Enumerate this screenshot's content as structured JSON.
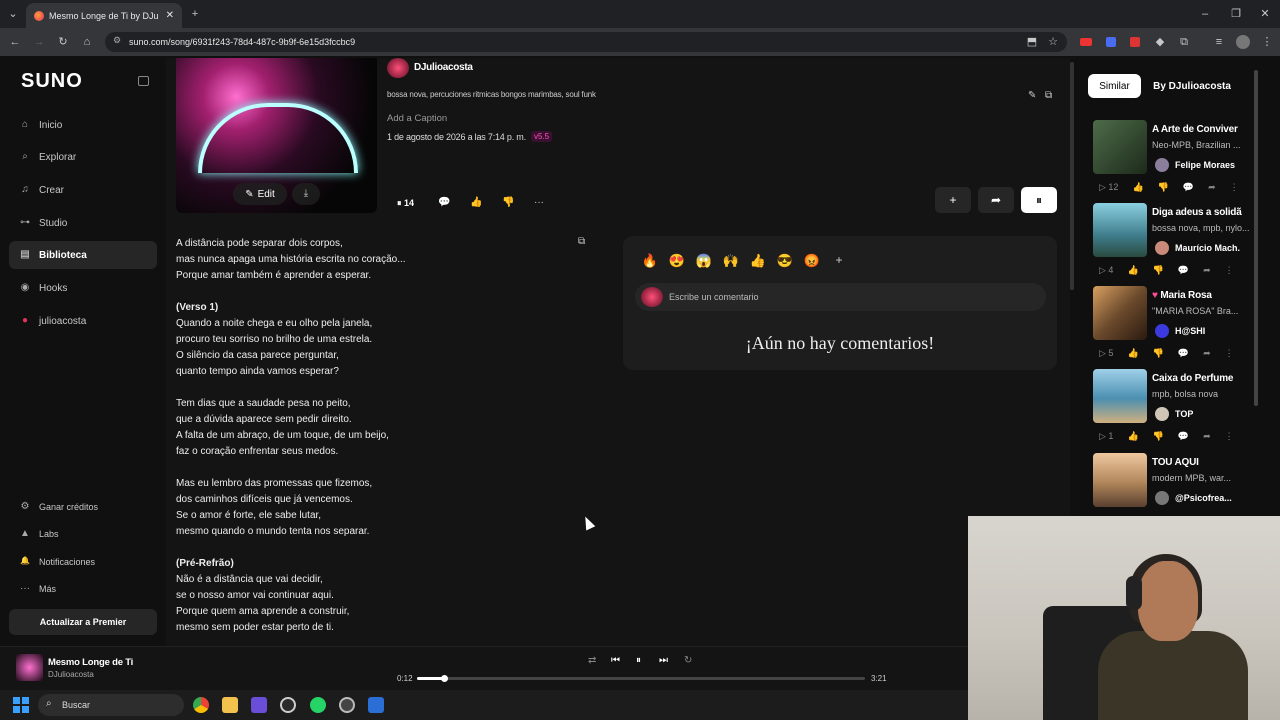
{
  "browser": {
    "tab_title": "Mesmo Longe de Ti by DJu",
    "url": "suno.com/song/6931f243-78d4-487c-9b9f-6e15d3fccbc9"
  },
  "sidebar": {
    "logo": "SUNO",
    "items": [
      {
        "label": "Inicio",
        "icon": "⌂"
      },
      {
        "label": "Explorar",
        "icon": "⌕"
      },
      {
        "label": "Crear",
        "icon": "♫"
      },
      {
        "label": "Studio",
        "icon": "⊶"
      },
      {
        "label": "Biblioteca",
        "icon": "▤"
      },
      {
        "label": "Hooks",
        "icon": "◉"
      },
      {
        "label": "julioacosta",
        "icon": "●"
      }
    ],
    "bottom_items": [
      {
        "label": "Ganar créditos",
        "icon": "⚙"
      },
      {
        "label": "Labs",
        "icon": "▲"
      },
      {
        "label": "Notificaciones",
        "icon": "🔔"
      },
      {
        "label": "Más",
        "icon": "···"
      }
    ],
    "premier_label": "Actualizar a Premier"
  },
  "song": {
    "artist": "DJulioacosta",
    "tags": "bossa nova, percuciones ritmicas bongos marimbas, soul funk",
    "caption_placeholder": "Add a Caption",
    "date": "1 de agosto de 2026 a las 7:14 p. m.",
    "version": "v5.5",
    "edit_label": "Edit",
    "play_count": "14"
  },
  "lyrics": [
    "A distância pode separar dois corpos,",
    "mas nunca apaga uma história escrita no coração...",
    "Porque amar também é aprender a esperar.",
    "",
    "(Verso 1)",
    "Quando a noite chega e eu olho pela janela,",
    "procuro teu sorriso no brilho de uma estrela.",
    "O silêncio da casa parece perguntar,",
    "quanto tempo ainda vamos esperar?",
    "",
    "Tem dias que a saudade pesa no peito,",
    "que a dúvida aparece sem pedir direito.",
    "A falta de um abraço, de um toque, de um beijo,",
    "faz o coração enfrentar seus medos.",
    "",
    "Mas eu lembro das promessas que fizemos,",
    "dos caminhos difíceis que já vencemos.",
    "Se o amor é forte, ele sabe lutar,",
    "mesmo quando o mundo tenta nos separar.",
    "",
    "(Pré-Refrão)",
    "Não é a distância que vai decidir,",
    "se o nosso amor vai continuar aqui.",
    "Porque quem ama aprende a construir,",
    "mesmo sem poder estar perto de ti."
  ],
  "comments": {
    "emojis": [
      "🔥",
      "😍",
      "😱",
      "🙌",
      "👍",
      "😎",
      "😡"
    ],
    "input_placeholder": "Escribe un comentario",
    "empty_message": "¡Aún no hay comentarios!"
  },
  "right_panel": {
    "tabs": [
      "Similar",
      "By DJulioacosta"
    ],
    "cards": [
      {
        "title": "A Arte de Conviver",
        "genre": "Neo-MPB, Brazilian ...",
        "user": "Felipe Moraes",
        "plays": "12",
        "thumb": "#4d6b4a"
      },
      {
        "title": "Diga adeus a solidã",
        "genre": "bossa nova, mpb, nylo...",
        "user": "Maurício Mach.",
        "plays": "4",
        "thumb": "#3f7d8c"
      },
      {
        "title": "Maria Rosa",
        "genre": "\"MARIA ROSA\" Bra...",
        "user": "H@SHI",
        "plays": "5",
        "thumb": "#6b4a2c"
      },
      {
        "title": "Caixa do Perfume",
        "genre": "mpb, bolsa nova",
        "user": "TOP",
        "plays": "1",
        "thumb": "#4b8fb0"
      },
      {
        "title": "TOU AQUI",
        "genre": "modern MPB, war...",
        "user": "@Psicofrea...",
        "plays": "",
        "thumb": "#b0865a"
      }
    ]
  },
  "player": {
    "title": "Mesmo Longe de Ti",
    "artist": "DJulioacosta",
    "current_time": "0:12",
    "duration": "3:21",
    "progress_fraction": 0.06
  },
  "taskbar": {
    "search_label": "Buscar"
  }
}
